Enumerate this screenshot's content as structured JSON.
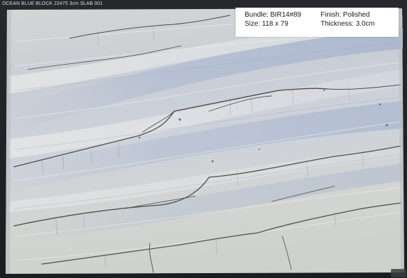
{
  "caption": "OCEAN BLUE BLOCK 22475 3cm SLAB 001",
  "info": {
    "bundle": "Bundle: BIR14#89",
    "finish": "Finish: Polished",
    "size": "Size: 118 x 79",
    "thickness": "Thickness: 3.0cm"
  },
  "colors": {
    "slab_base": "#c9ced6",
    "slab_light": "#dfe3e8",
    "slab_blue": "#b3bcd0",
    "vein": "#4a4a42",
    "background": "#1e1f22"
  }
}
